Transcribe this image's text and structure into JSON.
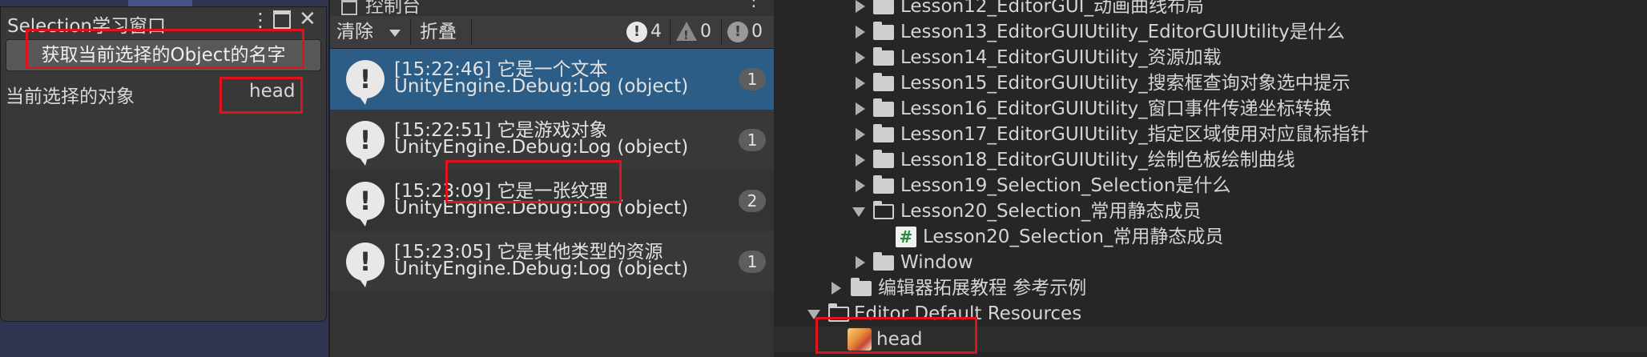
{
  "selection_window": {
    "title": "Selection学习窗口",
    "menu_icon": "kebab-menu-icon",
    "maximize_icon": "maximize-icon",
    "close_icon": "close-icon",
    "button_label": "获取当前选择的Object的名字",
    "field_label": "当前选择的对象",
    "field_value": "head"
  },
  "console": {
    "tab_label": "控制台",
    "menu": "⋮",
    "toolbar": {
      "clear_label": "清除",
      "collapse_label": "折叠",
      "info_count": "4",
      "warning_count": "0",
      "error_count": "0"
    },
    "logs": [
      {
        "line1": "[15:22:46] 它是一个文本",
        "line2": "UnityEngine.Debug:Log (object)",
        "count": "1",
        "selected": true
      },
      {
        "line1": "[15:22:51] 它是游戏对象",
        "line2": "UnityEngine.Debug:Log (object)",
        "count": "1",
        "selected": false
      },
      {
        "line1": "[15:23:09] 它是一张纹理",
        "line2": "UnityEngine.Debug:Log (object)",
        "count": "2",
        "selected": false
      },
      {
        "line1": "[15:23:05] 它是其他类型的资源",
        "line2": "UnityEngine.Debug:Log (object)",
        "count": "1",
        "selected": false
      }
    ]
  },
  "project_tree": {
    "items": [
      {
        "label": "Lesson12_EditorGUI_动画曲线布局"
      },
      {
        "label": "Lesson13_EditorGUIUtility_EditorGUIUtility是什么"
      },
      {
        "label": "Lesson14_EditorGUIUtility_资源加载"
      },
      {
        "label": "Lesson15_EditorGUIUtility_搜索框查询对象选中提示"
      },
      {
        "label": "Lesson16_EditorGUIUtility_窗口事件传递坐标转换"
      },
      {
        "label": "Lesson17_EditorGUIUtility_指定区域使用对应鼠标指针"
      },
      {
        "label": "Lesson18_EditorGUIUtility_绘制色板绘制曲线"
      },
      {
        "label": "Lesson19_Selection_Selection是什么"
      },
      {
        "label": "Lesson20_Selection_常用静态成员"
      },
      {
        "label": "Lesson20_Selection_常用静态成员"
      },
      {
        "label": "Window"
      },
      {
        "label": "编辑器拓展教程 参考示例"
      },
      {
        "label": "Editor Default Resources"
      },
      {
        "label": "head"
      }
    ]
  },
  "colors": {
    "highlight_red": "#e0121e",
    "selected_log": "#2c5d87",
    "panel": "#383838"
  }
}
